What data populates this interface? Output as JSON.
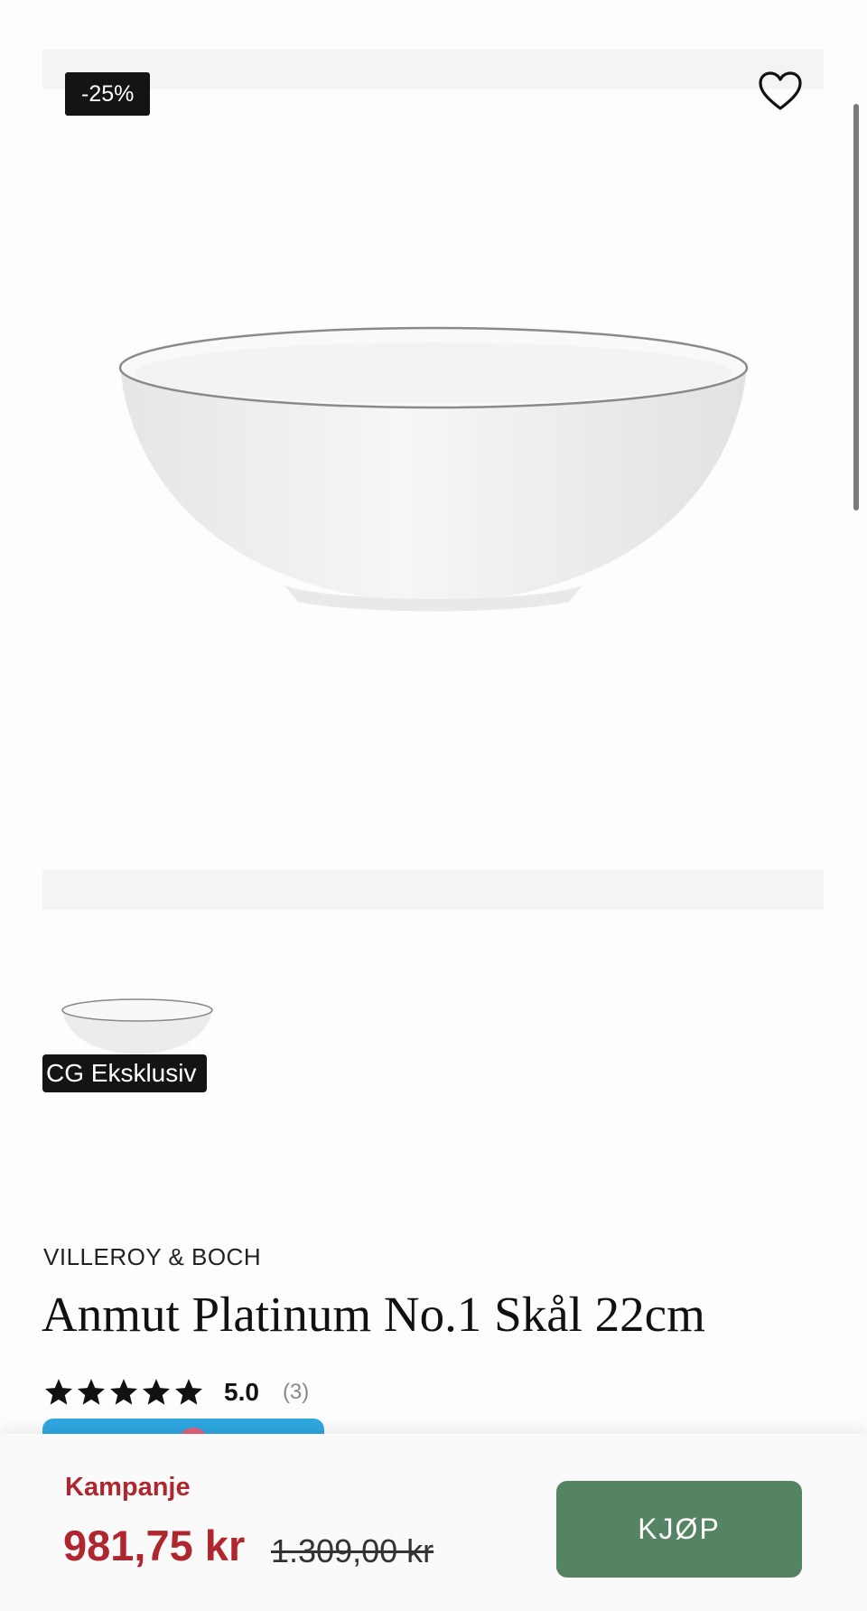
{
  "gallery": {
    "discount_badge": "-25%",
    "wishlist_icon": "heart-outline-icon",
    "main_image": "white-bowl-image",
    "thumbnail_image": "white-bowl-thumbnail",
    "thumbnail_badge": "CG Eksklusiv"
  },
  "product": {
    "brand": "VILLEROY & BOCH",
    "title": "Anmut Platinum No.1 Skål 22cm",
    "rating": {
      "stars": 5,
      "score": "5.0",
      "count": "(3)"
    }
  },
  "purchase": {
    "campaign_label": "Kampanje",
    "price": "981,75 kr",
    "original_price": "1.309,00 kr",
    "buy_label": "KJØP",
    "colors": {
      "campaign": "#b0262f",
      "buy_button": "#558462"
    }
  }
}
